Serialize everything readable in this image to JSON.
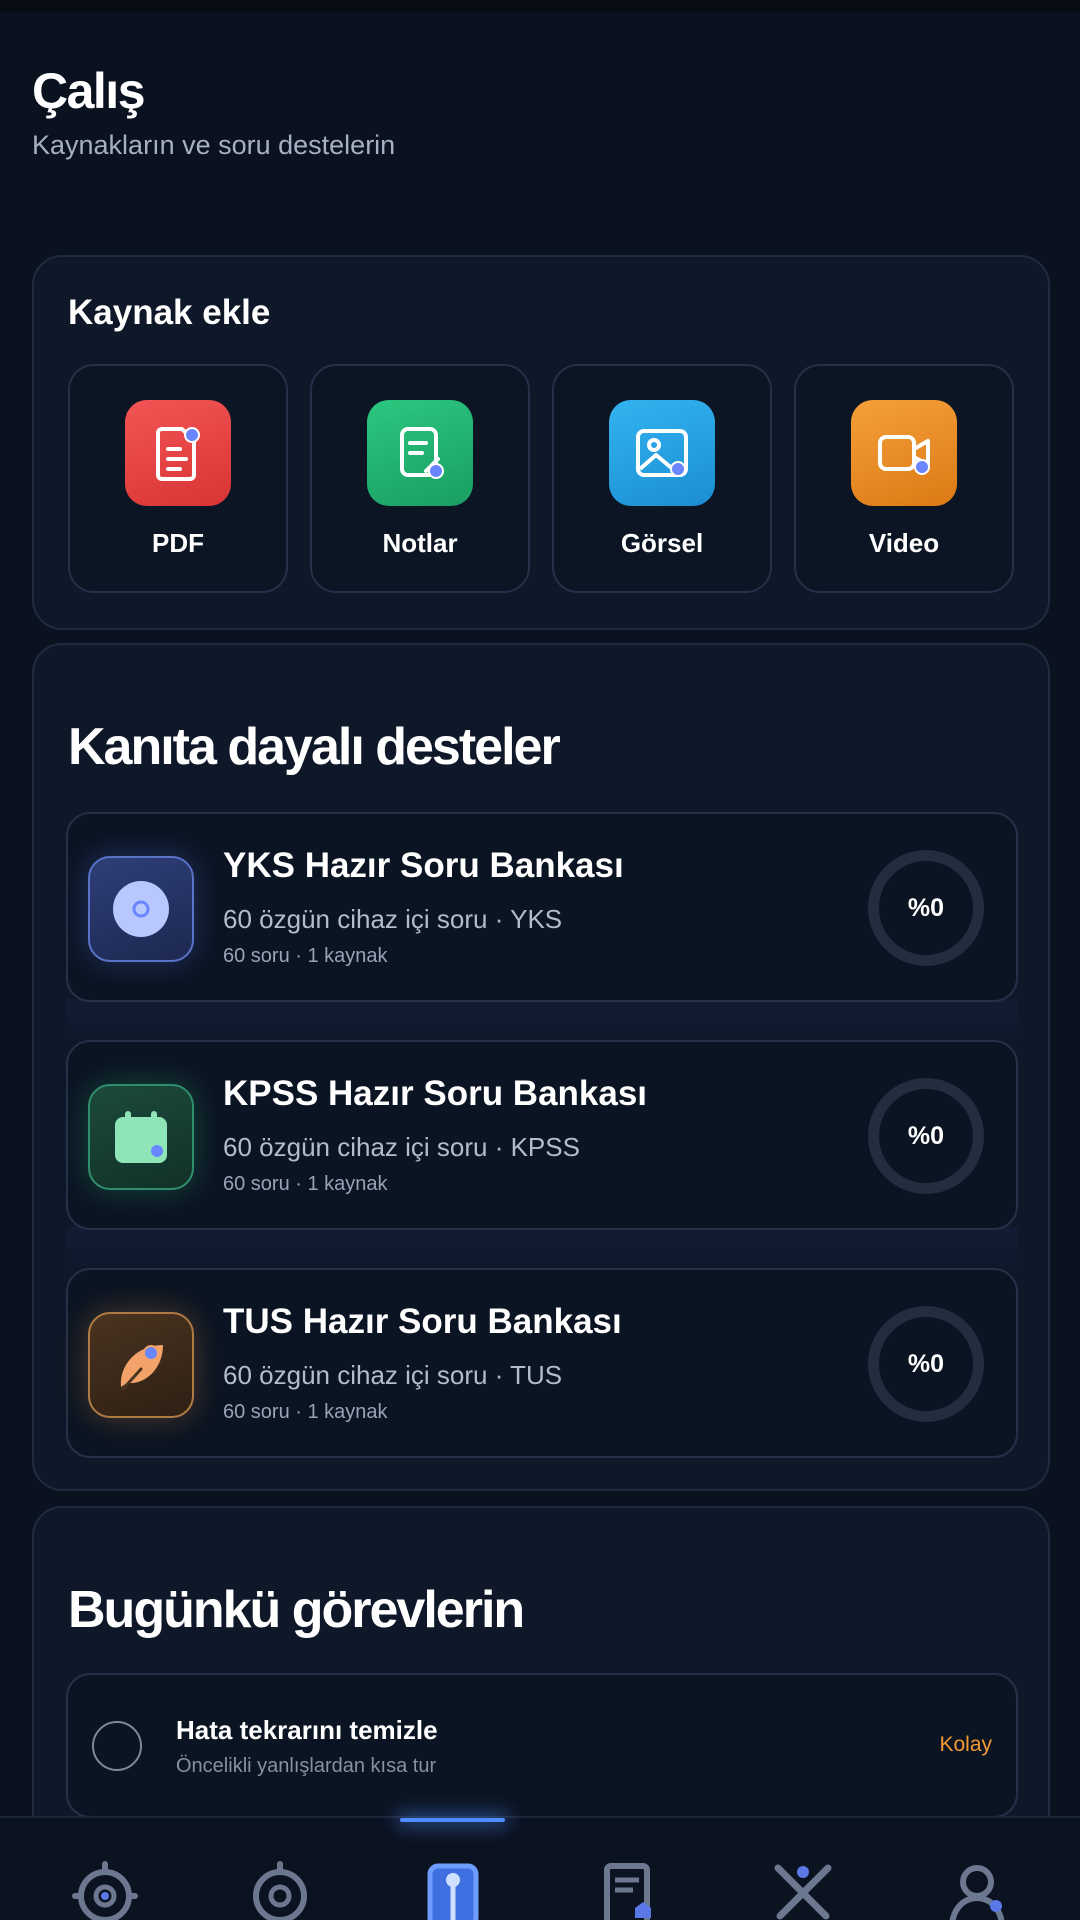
{
  "header": {
    "title": "Çalış",
    "subtitle": "Kaynakların ve soru destelerin"
  },
  "add_source": {
    "title": "Kaynak ekle",
    "items": [
      {
        "label": "PDF",
        "icon": "pdf-icon",
        "color": "#ef4444"
      },
      {
        "label": "Notlar",
        "icon": "note-icon",
        "color": "#22b873"
      },
      {
        "label": "Görsel",
        "icon": "image-icon",
        "color": "#2aa3e6"
      },
      {
        "label": "Video",
        "icon": "video-icon",
        "color": "#f08a24"
      }
    ]
  },
  "decks": {
    "title": "Kanıta dayalı desteler",
    "items": [
      {
        "title": "YKS Hazır Soru Bankası",
        "subtitle": "60 özgün cihaz içi soru · YKS",
        "meta": "60 soru · 1 kaynak",
        "progress": "%0",
        "icon": "disc-icon"
      },
      {
        "title": "KPSS Hazır Soru Bankası",
        "subtitle": "60 özgün cihaz içi soru · KPSS",
        "meta": "60 soru · 1 kaynak",
        "progress": "%0",
        "icon": "calendar-icon"
      },
      {
        "title": "TUS Hazır Soru Bankası",
        "subtitle": "60 özgün cihaz içi soru · TUS",
        "meta": "60 soru · 1 kaynak",
        "progress": "%0",
        "icon": "leaf-icon"
      }
    ]
  },
  "tasks": {
    "title": "Bugünkü görevlerin",
    "items": [
      {
        "title": "Hata tekrarını temizle",
        "subtitle": "Öncelikli yanlışlardan kısa tur",
        "badge": "Kolay"
      }
    ]
  },
  "nav": {
    "items": [
      {
        "icon": "target-dot-icon"
      },
      {
        "icon": "target-icon"
      },
      {
        "icon": "study-icon",
        "active": true
      },
      {
        "icon": "document-icon"
      },
      {
        "icon": "crossed-tools-icon"
      },
      {
        "icon": "profile-icon"
      }
    ]
  },
  "colors": {
    "accent": "#4d8dff",
    "badge_easy": "#f39a34",
    "background": "#0a1220"
  }
}
